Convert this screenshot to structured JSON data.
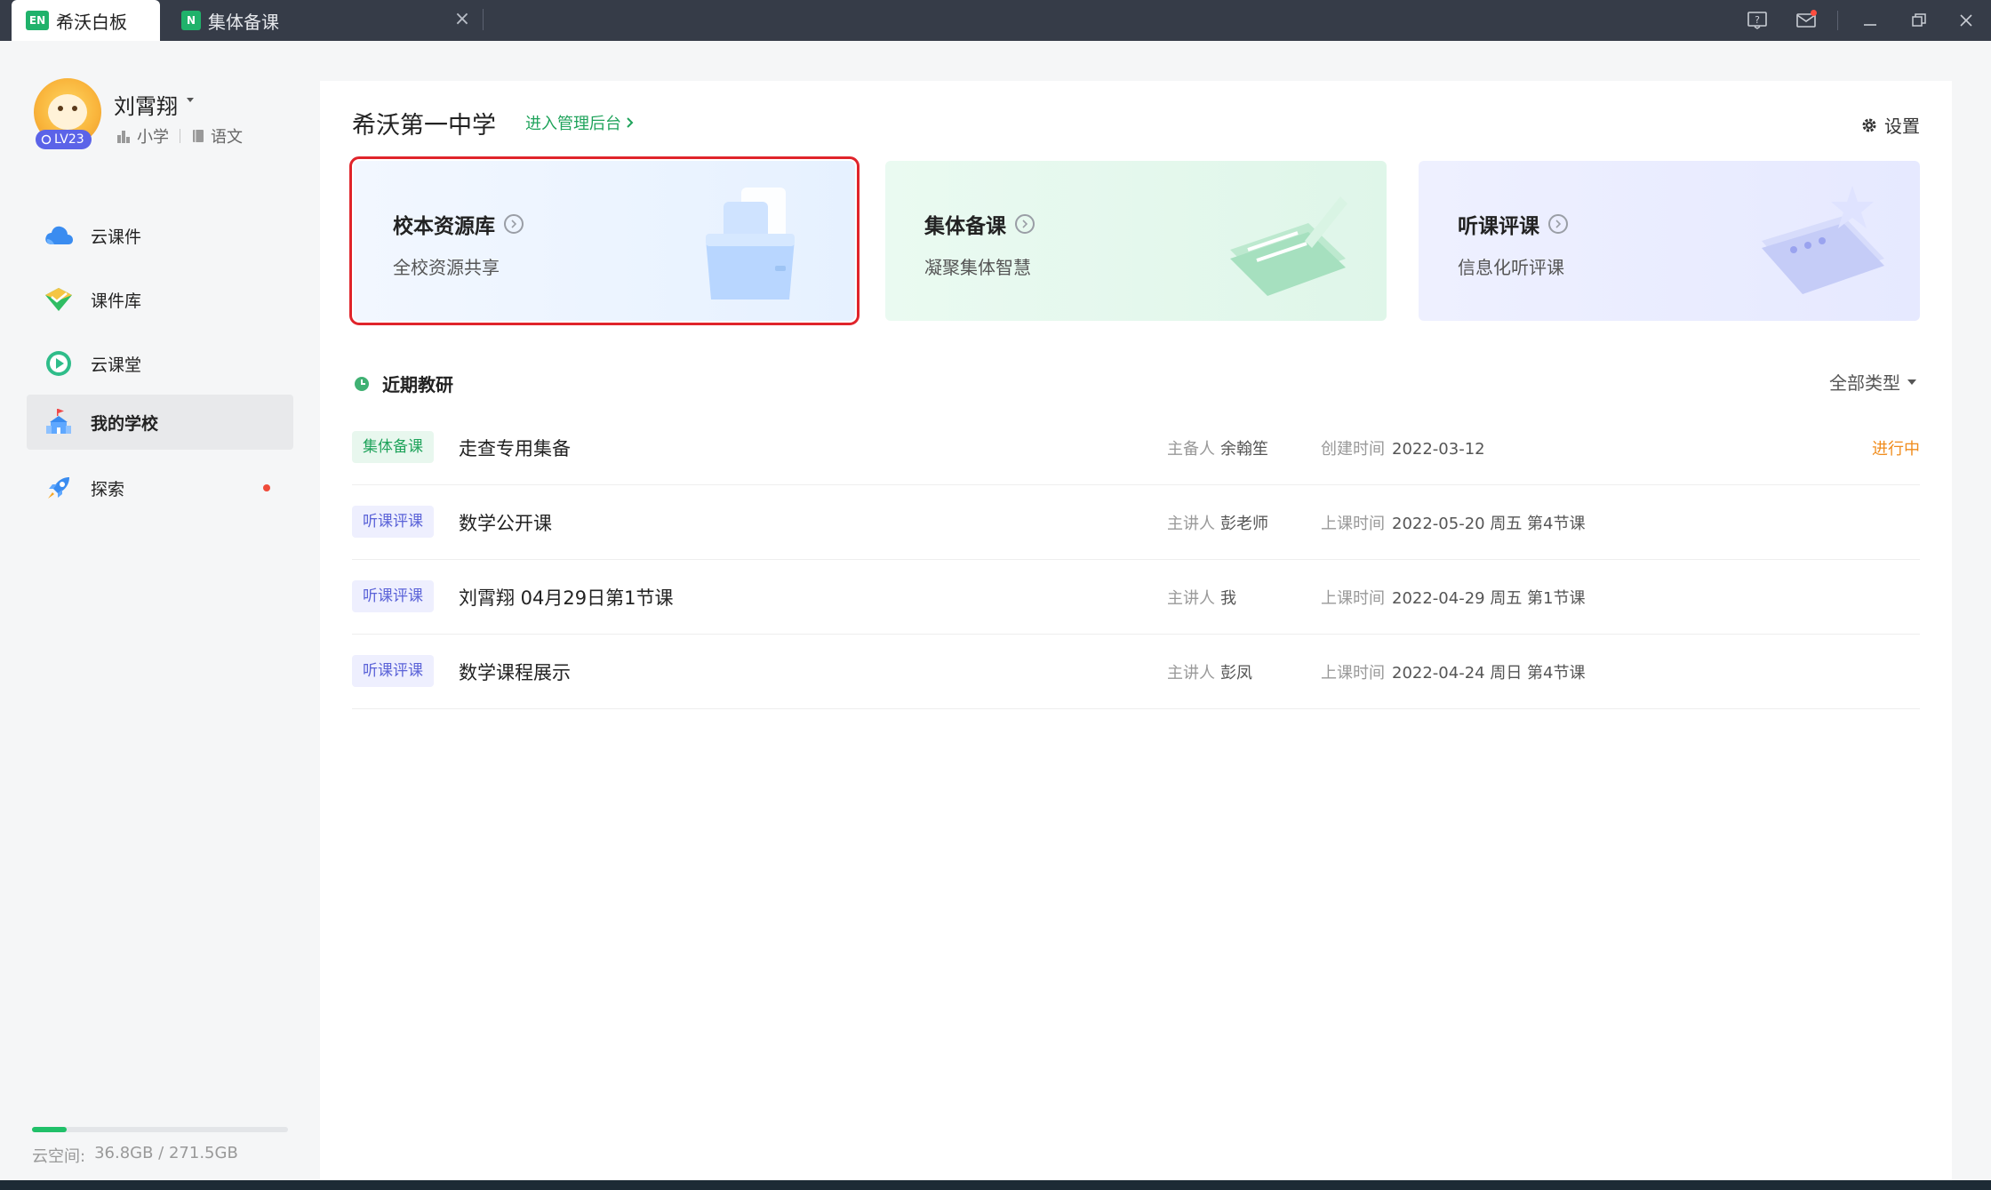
{
  "titlebar": {
    "app_tab": {
      "logo": "EN",
      "title": "希沃白板"
    },
    "second_tab": {
      "logo": "N",
      "title": "集体备课",
      "close": "×"
    }
  },
  "user": {
    "name": "刘霄翔",
    "level": "LV23",
    "stage": "小学",
    "subject": "语文"
  },
  "nav": [
    {
      "label": "云课件",
      "icon": "cloud-icon"
    },
    {
      "label": "课件库",
      "icon": "courseware-library-icon"
    },
    {
      "label": "云课堂",
      "icon": "play-circle-icon"
    },
    {
      "label": "我的学校",
      "icon": "school-icon",
      "active": true
    },
    {
      "label": "探索",
      "icon": "rocket-icon",
      "badge_dot": true
    }
  ],
  "storage": {
    "label": "云空间:",
    "value": "36.8GB / 271.5GB",
    "used_fraction": 0.136
  },
  "header": {
    "school_name": "希沃第一中学",
    "admin_link": "进入管理后台",
    "settings": "设置"
  },
  "cards": [
    {
      "title": "校本资源库",
      "subtitle": "全校资源共享"
    },
    {
      "title": "集体备课",
      "subtitle": "凝聚集体智慧"
    },
    {
      "title": "听课评课",
      "subtitle": "信息化听评课"
    }
  ],
  "recent": {
    "title": "近期教研",
    "filter": "全部类型",
    "rows": [
      {
        "tag": "集体备课",
        "title": "走查专用集备",
        "owner_label": "主备人",
        "owner": "余翰笙",
        "time_label": "创建时间",
        "time": "2022-03-12",
        "status": "进行中"
      },
      {
        "tag": "听课评课",
        "title": "数学公开课",
        "owner_label": "主讲人",
        "owner": "彭老师",
        "time_label": "上课时间",
        "time": "2022-05-20 周五 第4节课",
        "status": ""
      },
      {
        "tag": "听课评课",
        "title": "刘霄翔 04月29日第1节课",
        "owner_label": "主讲人",
        "owner": "我",
        "time_label": "上课时间",
        "time": "2022-04-29 周五 第1节课",
        "status": ""
      },
      {
        "tag": "听课评课",
        "title": "数学课程展示",
        "owner_label": "主讲人",
        "owner": "彭凤",
        "time_label": "上课时间",
        "time": "2022-04-24 周日 第4节课",
        "status": ""
      }
    ]
  },
  "colors": {
    "accent_green": "#1fa35b",
    "status_orange": "#f08c1c",
    "highlight_red": "#e0242b",
    "titlebar": "#363c48"
  }
}
